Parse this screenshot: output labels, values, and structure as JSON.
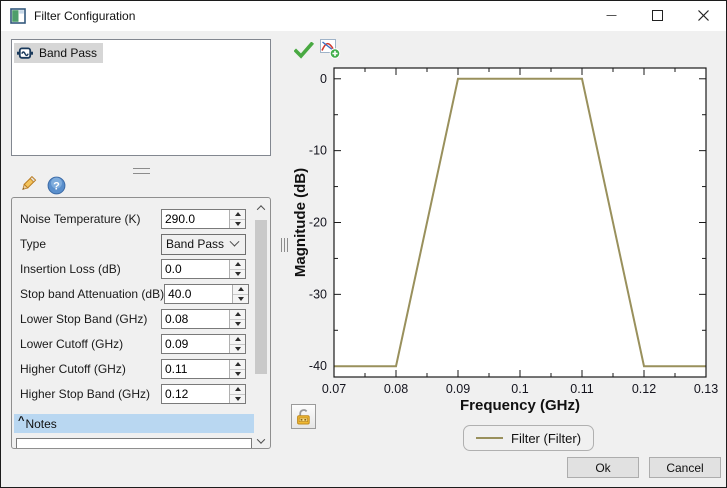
{
  "window": {
    "title": "Filter Configuration"
  },
  "titlebar_icons": {
    "app": "app-window",
    "minimize": "minimize",
    "maximize": "maximize",
    "close": "close"
  },
  "filters_list": {
    "items": [
      {
        "label": "Band Pass",
        "icon": "filter-component",
        "selected": true
      }
    ]
  },
  "toolbar": {
    "edit_icon": "pencil",
    "help_icon": "question-mark"
  },
  "form": {
    "fields": [
      {
        "label": "Noise Temperature (K)",
        "value": "290.0",
        "type": "spin"
      },
      {
        "label": "Type",
        "value": "Band Pass",
        "type": "combo"
      },
      {
        "label": "Insertion Loss (dB)",
        "value": "0.0",
        "type": "spin"
      },
      {
        "label": "Stop band Attenuation (dB)",
        "value": "40.0",
        "type": "spin"
      },
      {
        "label": "Lower Stop Band (GHz)",
        "value": "0.08",
        "type": "spin"
      },
      {
        "label": "Lower Cutoff (GHz)",
        "value": "0.09",
        "type": "spin"
      },
      {
        "label": "Higher Cutoff (GHz)",
        "value": "0.11",
        "type": "spin"
      },
      {
        "label": "Higher Stop Band (GHz)",
        "value": "0.12",
        "type": "spin"
      }
    ],
    "notes": {
      "caret": "^",
      "label": "Notes",
      "value": ""
    }
  },
  "chart_toolbar": {
    "validate_icon": "green-check",
    "add_plot_icon": "chart-add",
    "axis_lock_icon": "padlock-open"
  },
  "chart_data": {
    "type": "line",
    "title": "",
    "xlabel": "Frequency (GHz)",
    "ylabel": "Magnitude (dB)",
    "xlim": [
      0.07,
      0.13
    ],
    "ylim": [
      -41.5,
      1.5
    ],
    "xticks": [
      0.07,
      0.08,
      0.09,
      0.1,
      0.11,
      0.12,
      0.13
    ],
    "xtick_labels": [
      "0.07",
      "0.08",
      "0.09",
      "0.1",
      "0.11",
      "0.12",
      "0.13"
    ],
    "yticks": [
      0,
      -10,
      -20,
      -30,
      -40
    ],
    "ytick_labels": [
      "0",
      "-10",
      "-20",
      "-30",
      "-40"
    ],
    "minor_xticks": [
      0.075,
      0.085,
      0.095,
      0.105,
      0.115,
      0.125
    ],
    "minor_yticks": [
      -5,
      -15,
      -25,
      -35
    ],
    "grid": false,
    "legend_position": "below",
    "series": [
      {
        "name": "Filter (Filter)",
        "color": "#99905c",
        "x": [
          0.07,
          0.08,
          0.09,
          0.11,
          0.12,
          0.13
        ],
        "y": [
          -40,
          -40,
          0,
          0,
          -40,
          -40
        ]
      }
    ]
  },
  "buttons": {
    "ok": "Ok",
    "cancel": "Cancel"
  },
  "colors": {
    "dialog_bg": "#f0f0f0",
    "titlebar_bg": "#ffffff",
    "selection_blue": "#b9d7f1",
    "line_olive": "#99905c"
  }
}
